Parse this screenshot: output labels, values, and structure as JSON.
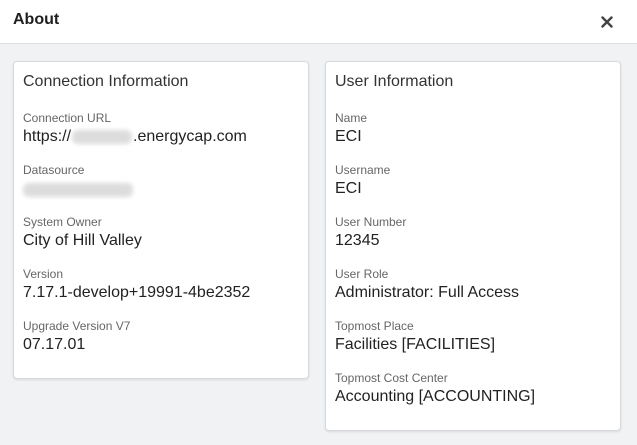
{
  "dialog": {
    "title": "About",
    "close_icon": "close-icon"
  },
  "connection": {
    "title": "Connection Information",
    "url_label": "Connection URL",
    "url_prefix": "https://",
    "url_suffix": ".energycap.com",
    "datasource_label": "Datasource",
    "owner_label": "System Owner",
    "owner_value": "City of Hill Valley",
    "version_label": "Version",
    "version_value": "7.17.1-develop+19991-4be2352",
    "upgrade_label": "Upgrade Version V7",
    "upgrade_value": "07.17.01"
  },
  "user": {
    "title": "User Information",
    "name_label": "Name",
    "name_value": "ECI",
    "username_label": "Username",
    "username_value": "ECI",
    "number_label": "User Number",
    "number_value": "12345",
    "role_label": "User Role",
    "role_value": "Administrator: Full Access",
    "place_label": "Topmost Place",
    "place_value": "Facilities [FACILITIES]",
    "cost_label": "Topmost Cost Center",
    "cost_value": "Accounting [ACCOUNTING]"
  },
  "colors": {
    "background": "#f1f2f4",
    "card": "#ffffff",
    "border": "#d6d9dd"
  }
}
